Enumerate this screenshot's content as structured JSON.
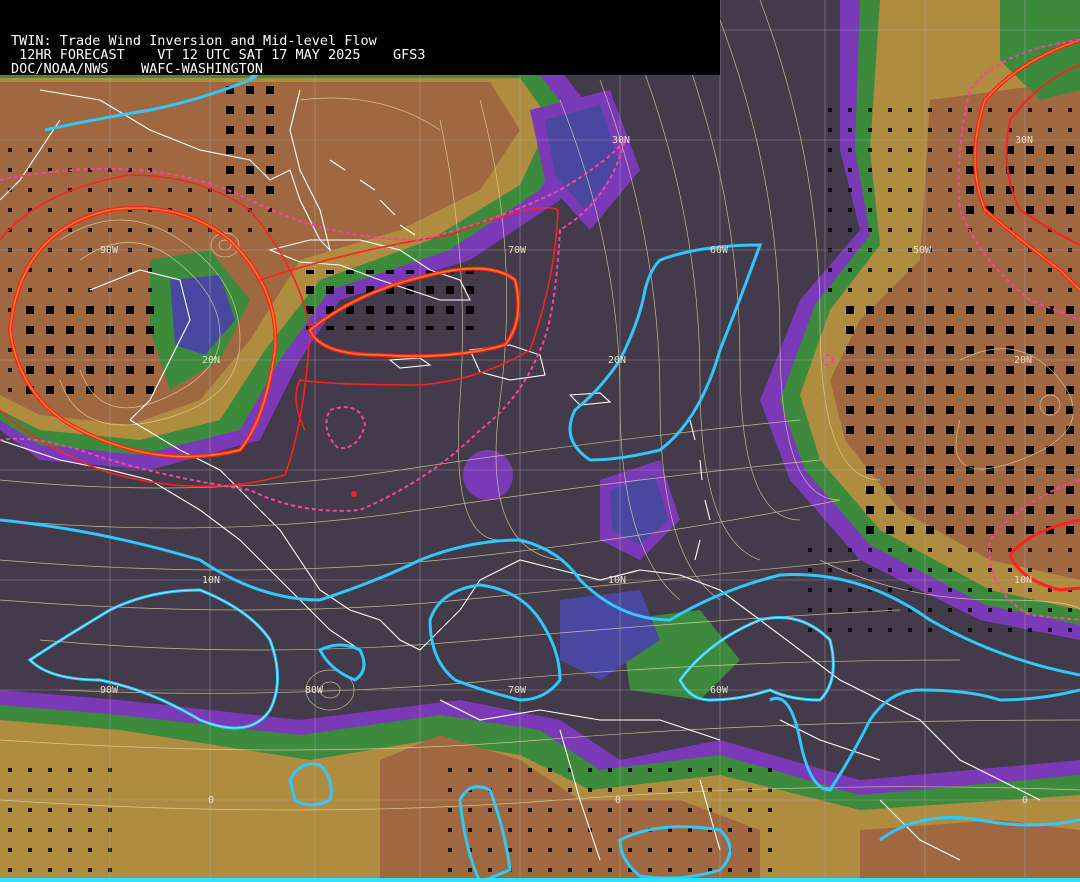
{
  "header": {
    "line1": "TWIN: Trade Wind Inversion and Mid-level Flow",
    "line2": " 12HR FORECAST    VT 12 UTC SAT 17 MAY 2025    GFS3",
    "line3": "DOC/NOAA/NWS    WAFC-WASHINGTON"
  },
  "grid_labels": {
    "lat_30n": "30N",
    "lat_20n": "20N",
    "lat_10n": "10N",
    "lat_0": "0",
    "lon_90w": "90W",
    "lon_80w": "80W",
    "lon_70w": "70W",
    "lon_60w": "60W",
    "lon_50w": "50W"
  },
  "colors": {
    "background": "#433a4a",
    "inversion_low": "#a06840",
    "inversion_mid": "#b08c40",
    "inversion_green": "#3c8a3c",
    "inversion_purple": "#7a3ab8",
    "inversion_blue": "#4848a0",
    "isoline_red": "#ff2020",
    "isoline_orange": "#ff7a20",
    "isoline_pink": "#ff40a0",
    "isoline_cyan": "#30c8ff",
    "streamline": "#e8d8a0",
    "coastline": "#ffffff",
    "grid": "#a8a8a8"
  }
}
